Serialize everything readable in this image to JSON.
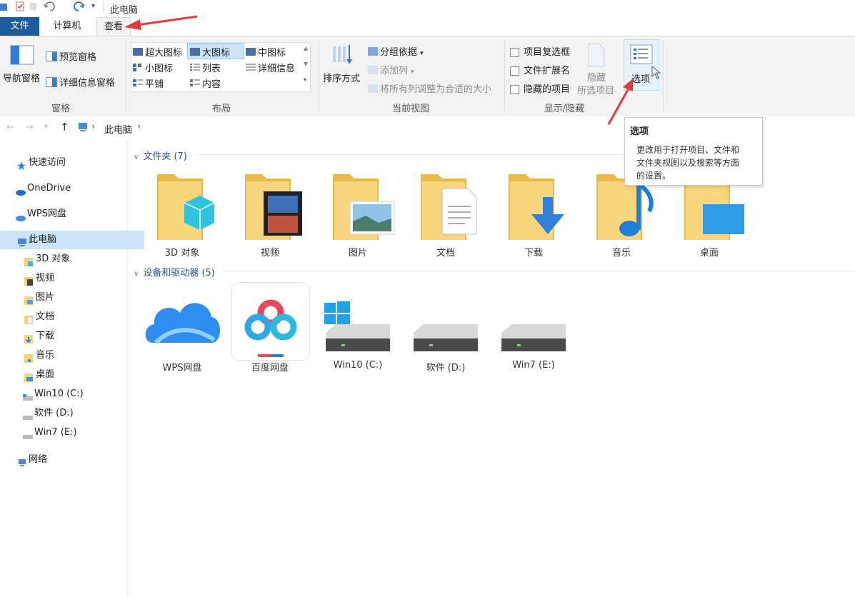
{
  "titlebar": {
    "title": "此电脑",
    "qa_dropdown": "▾"
  },
  "tabs": {
    "file": "文件",
    "computer": "计算机",
    "view": "查看"
  },
  "ribbon": {
    "pane": {
      "preview": "预览窗格",
      "nav_pane": "导航窗格",
      "details": "详细信息窗格",
      "label": "窗格"
    },
    "layout": {
      "items": [
        "超大图标",
        "大图标",
        "中图标",
        "小图标",
        "列表",
        "详细信息",
        "平铺",
        "内容"
      ],
      "label": "布局"
    },
    "current_view": {
      "sort_by": "排序方式",
      "group_by": "分组依据",
      "add_column": "添加列",
      "fit_columns": "将所有列调整为合适的大小",
      "label": "当前视图"
    },
    "show_hide": {
      "item_checkboxes": "项目复选框",
      "file_extensions": "文件扩展名",
      "hidden_items": "隐藏的项目",
      "hide_selected_line1": "隐藏",
      "hide_selected_line2": "所选项目",
      "options": "选项",
      "label": "显示/隐藏"
    }
  },
  "address": {
    "path": "此电脑",
    "chevron": "›"
  },
  "sidebar": {
    "quick_access": "快速访问",
    "onedrive": "OneDrive",
    "wps": "WPS网盘",
    "this_pc": "此电脑",
    "items": [
      "3D 对象",
      "视频",
      "图片",
      "文档",
      "下载",
      "音乐",
      "桌面",
      "Win10 (C:)",
      "软件 (D:)",
      "Win7 (E:)"
    ],
    "network": "网络"
  },
  "folders": {
    "header": "文件夹 (7)",
    "items": [
      "3D 对象",
      "视频",
      "图片",
      "文档",
      "下载",
      "音乐",
      "桌面"
    ]
  },
  "devices": {
    "header": "设备和驱动器 (5)",
    "items": [
      "WPS网盘",
      "百度网盘",
      "Win10 (C:)",
      "软件 (D:)",
      "Win7 (E:)"
    ]
  },
  "tooltip": {
    "title": "选项",
    "body_line1": "更改用于打开项目、文件和",
    "body_line2": "文件夹视图以及搜索等方面",
    "body_line3": "的设置。"
  },
  "colors": {
    "accent": "#1e5a9e",
    "folder": "#f5d277",
    "annotation_arrow": "#e23b3b",
    "selected": "#cce4f7"
  }
}
